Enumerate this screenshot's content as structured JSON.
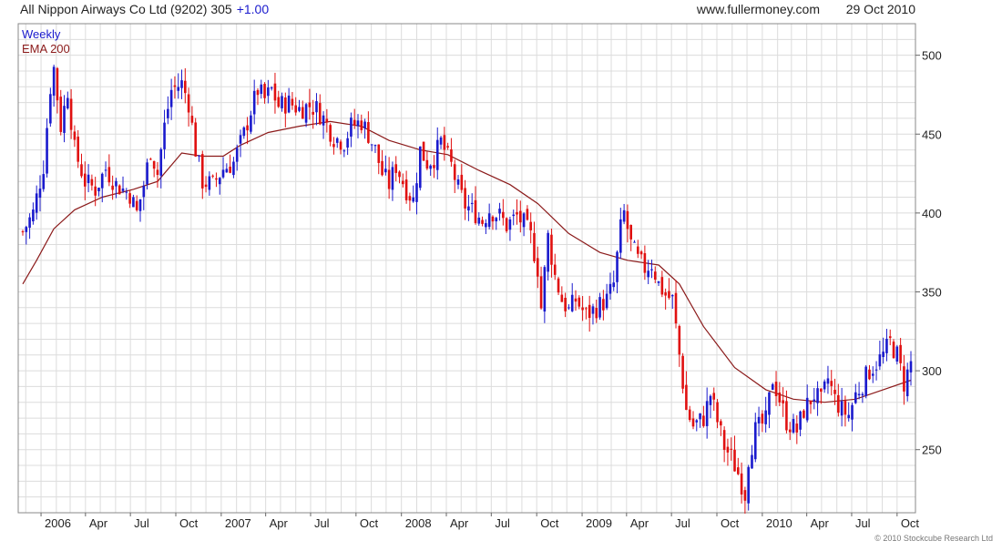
{
  "header": {
    "title": "All Nippon Airways Co Ltd (9202) 305",
    "change": "+1.00",
    "site": "www.fullermoney.com",
    "date": "29 Oct 2010"
  },
  "legend": {
    "weekly": "Weekly",
    "ema": "EMA 200"
  },
  "footer": {
    "copyright": "© 2010 Stockcube Research Ltd"
  },
  "colors": {
    "up": "#1a1acd",
    "down": "#e01010",
    "ema": "#8b1a1a",
    "grid": "#dcdcdc",
    "frame": "#888888",
    "title_change": "#1a1acd"
  },
  "chart_data": {
    "type": "candlestick",
    "interval": "weekly",
    "x_axis": {
      "range": [
        "2005-11-25",
        "2010-10-29"
      ],
      "tick_labels": [
        {
          "label": "2006",
          "date": "2006-01-01"
        },
        {
          "label": "Apr",
          "date": "2006-04-01"
        },
        {
          "label": "Jul",
          "date": "2006-07-01"
        },
        {
          "label": "Oct",
          "date": "2006-10-01"
        },
        {
          "label": "2007",
          "date": "2007-01-01"
        },
        {
          "label": "Apr",
          "date": "2007-04-01"
        },
        {
          "label": "Jul",
          "date": "2007-07-01"
        },
        {
          "label": "Oct",
          "date": "2007-10-01"
        },
        {
          "label": "2008",
          "date": "2008-01-01"
        },
        {
          "label": "Apr",
          "date": "2008-04-01"
        },
        {
          "label": "Jul",
          "date": "2008-07-01"
        },
        {
          "label": "Oct",
          "date": "2008-10-01"
        },
        {
          "label": "2009",
          "date": "2009-01-01"
        },
        {
          "label": "Apr",
          "date": "2009-04-01"
        },
        {
          "label": "Jul",
          "date": "2009-07-01"
        },
        {
          "label": "Oct",
          "date": "2009-10-01"
        },
        {
          "label": "2010",
          "date": "2010-01-01"
        },
        {
          "label": "Apr",
          "date": "2010-04-01"
        },
        {
          "label": "Jul",
          "date": "2010-07-01"
        },
        {
          "label": "Oct",
          "date": "2010-10-01"
        }
      ]
    },
    "y_axis": {
      "range": [
        210,
        520
      ],
      "ticks": [
        250,
        300,
        350,
        400,
        450,
        500
      ],
      "side": "right"
    },
    "grid": true,
    "price_path": [
      [
        "2005-11-25",
        388
      ],
      [
        "2005-12-16",
        400
      ],
      [
        "2006-01-06",
        430
      ],
      [
        "2006-01-20",
        480
      ],
      [
        "2006-01-27",
        492
      ],
      [
        "2006-02-10",
        455
      ],
      [
        "2006-02-24",
        478
      ],
      [
        "2006-03-10",
        440
      ],
      [
        "2006-03-31",
        420
      ],
      [
        "2006-04-21",
        415
      ],
      [
        "2006-05-12",
        428
      ],
      [
        "2006-06-02",
        418
      ],
      [
        "2006-06-30",
        412
      ],
      [
        "2006-07-14",
        400
      ],
      [
        "2006-07-28",
        418
      ],
      [
        "2006-08-11",
        440
      ],
      [
        "2006-08-25",
        425
      ],
      [
        "2006-09-08",
        455
      ],
      [
        "2006-09-22",
        478
      ],
      [
        "2006-10-13",
        482
      ],
      [
        "2006-10-27",
        470
      ],
      [
        "2006-11-10",
        440
      ],
      [
        "2006-11-24",
        420
      ],
      [
        "2006-12-15",
        418
      ],
      [
        "2007-01-05",
        428
      ],
      [
        "2007-01-26",
        432
      ],
      [
        "2007-02-16",
        450
      ],
      [
        "2007-03-02",
        465
      ],
      [
        "2007-03-16",
        478
      ],
      [
        "2007-03-30",
        472
      ],
      [
        "2007-04-13",
        478
      ],
      [
        "2007-04-27",
        468
      ],
      [
        "2007-05-18",
        470
      ],
      [
        "2007-06-08",
        466
      ],
      [
        "2007-06-29",
        468
      ],
      [
        "2007-07-13",
        466
      ],
      [
        "2007-07-27",
        460
      ],
      [
        "2007-08-17",
        448
      ],
      [
        "2007-09-07",
        445
      ],
      [
        "2007-09-21",
        455
      ],
      [
        "2007-10-12",
        458
      ],
      [
        "2007-10-26",
        450
      ],
      [
        "2007-11-09",
        440
      ],
      [
        "2007-11-23",
        425
      ],
      [
        "2007-12-07",
        418
      ],
      [
        "2007-12-21",
        430
      ],
      [
        "2008-01-11",
        415
      ],
      [
        "2008-01-25",
        408
      ],
      [
        "2008-02-08",
        440
      ],
      [
        "2008-02-22",
        432
      ],
      [
        "2008-03-07",
        435
      ],
      [
        "2008-03-21",
        445
      ],
      [
        "2008-04-11",
        430
      ],
      [
        "2008-04-25",
        415
      ],
      [
        "2008-05-09",
        405
      ],
      [
        "2008-05-30",
        400
      ],
      [
        "2008-06-13",
        395
      ],
      [
        "2008-06-27",
        402
      ],
      [
        "2008-07-18",
        398
      ],
      [
        "2008-08-01",
        392
      ],
      [
        "2008-08-22",
        398
      ],
      [
        "2008-09-05",
        393
      ],
      [
        "2008-09-19",
        385
      ],
      [
        "2008-10-03",
        365
      ],
      [
        "2008-10-10",
        340
      ],
      [
        "2008-10-24",
        385
      ],
      [
        "2008-11-07",
        360
      ],
      [
        "2008-11-21",
        345
      ],
      [
        "2008-12-05",
        338
      ],
      [
        "2008-12-19",
        345
      ],
      [
        "2009-01-09",
        335
      ],
      [
        "2009-01-30",
        340
      ],
      [
        "2009-02-20",
        345
      ],
      [
        "2009-03-06",
        355
      ],
      [
        "2009-03-20",
        390
      ],
      [
        "2009-03-27",
        400
      ],
      [
        "2009-04-10",
        380
      ],
      [
        "2009-04-24",
        370
      ],
      [
        "2009-05-08",
        365
      ],
      [
        "2009-05-22",
        368
      ],
      [
        "2009-06-05",
        355
      ],
      [
        "2009-06-19",
        348
      ],
      [
        "2009-07-03",
        345
      ],
      [
        "2009-07-17",
        310
      ],
      [
        "2009-07-31",
        275
      ],
      [
        "2009-08-14",
        265
      ],
      [
        "2009-09-04",
        270
      ],
      [
        "2009-09-18",
        285
      ],
      [
        "2009-10-02",
        268
      ],
      [
        "2009-10-16",
        252
      ],
      [
        "2009-10-30",
        245
      ],
      [
        "2009-11-13",
        235
      ],
      [
        "2009-11-27",
        222
      ],
      [
        "2009-12-04",
        245
      ],
      [
        "2009-12-18",
        262
      ],
      [
        "2010-01-08",
        268
      ],
      [
        "2010-01-22",
        295
      ],
      [
        "2010-02-05",
        282
      ],
      [
        "2010-02-19",
        268
      ],
      [
        "2010-03-12",
        262
      ],
      [
        "2010-03-26",
        275
      ],
      [
        "2010-04-16",
        285
      ],
      [
        "2010-04-30",
        280
      ],
      [
        "2010-05-14",
        295
      ],
      [
        "2010-05-28",
        282
      ],
      [
        "2010-06-11",
        275
      ],
      [
        "2010-06-25",
        272
      ],
      [
        "2010-07-09",
        285
      ],
      [
        "2010-07-23",
        292
      ],
      [
        "2010-08-06",
        300
      ],
      [
        "2010-08-20",
        305
      ],
      [
        "2010-09-03",
        310
      ],
      [
        "2010-09-17",
        318
      ],
      [
        "2010-10-01",
        310
      ],
      [
        "2010-10-15",
        292
      ],
      [
        "2010-10-29",
        305
      ]
    ],
    "ema_200": [
      [
        "2005-11-25",
        355
      ],
      [
        "2005-12-23",
        370
      ],
      [
        "2006-01-27",
        390
      ],
      [
        "2006-03-10",
        402
      ],
      [
        "2006-05-05",
        410
      ],
      [
        "2006-07-07",
        415
      ],
      [
        "2006-08-25",
        420
      ],
      [
        "2006-10-13",
        438
      ],
      [
        "2006-11-24",
        436
      ],
      [
        "2007-01-05",
        436
      ],
      [
        "2007-02-09",
        443
      ],
      [
        "2007-04-06",
        451
      ],
      [
        "2007-06-08",
        455
      ],
      [
        "2007-08-10",
        458
      ],
      [
        "2007-10-12",
        455
      ],
      [
        "2007-12-07",
        446
      ],
      [
        "2008-02-08",
        440
      ],
      [
        "2008-04-04",
        437
      ],
      [
        "2008-06-06",
        427
      ],
      [
        "2008-08-08",
        418
      ],
      [
        "2008-10-03",
        406
      ],
      [
        "2008-12-05",
        387
      ],
      [
        "2009-02-06",
        375
      ],
      [
        "2009-04-03",
        370
      ],
      [
        "2009-06-05",
        367
      ],
      [
        "2009-07-17",
        355
      ],
      [
        "2009-09-04",
        328
      ],
      [
        "2009-11-06",
        302
      ],
      [
        "2010-01-08",
        288
      ],
      [
        "2010-03-05",
        282
      ],
      [
        "2010-05-07",
        280
      ],
      [
        "2010-07-09",
        282
      ],
      [
        "2010-09-03",
        288
      ],
      [
        "2010-10-29",
        294
      ]
    ]
  }
}
